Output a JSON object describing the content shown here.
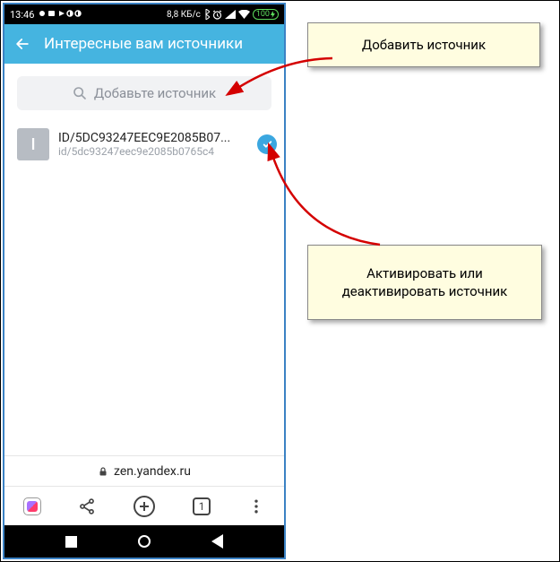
{
  "status": {
    "time": "13:46",
    "net_speed": "8,8 КБ/с",
    "battery": "100"
  },
  "header": {
    "title": "Интересные вам источники"
  },
  "search": {
    "placeholder": "Добавьте источник"
  },
  "source": {
    "avatar_letter": "I",
    "title": "ID/5DC93247EEC9E2085B07...",
    "subtitle": "id/5dc93247eec9e2085b0765c4"
  },
  "browser": {
    "url_display": "zen.yandex.ru",
    "tab_count": "1"
  },
  "callouts": {
    "add": "Добавить источник",
    "toggle": "Активировать или деактивировать источник"
  }
}
